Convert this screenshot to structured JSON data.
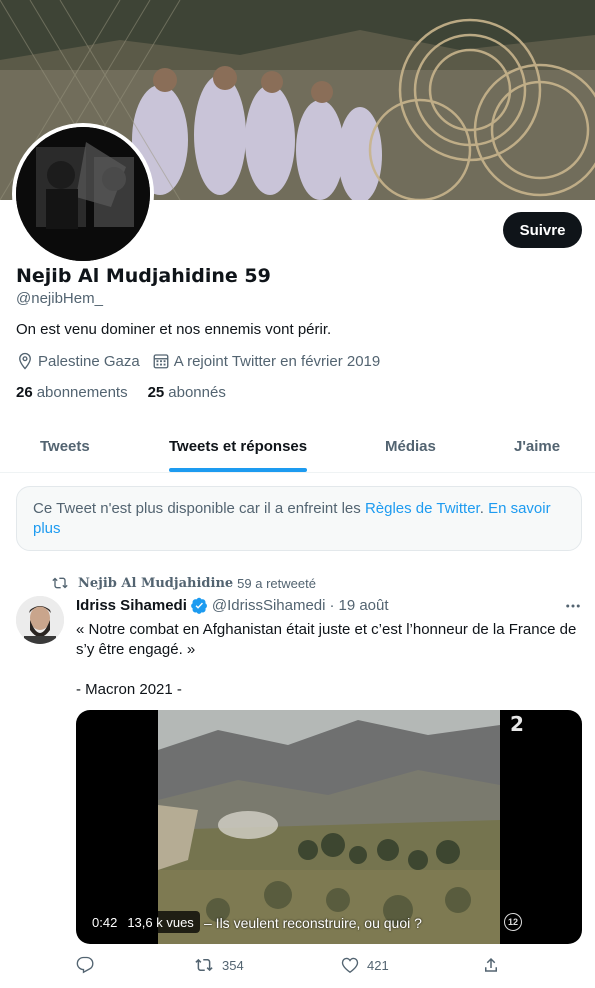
{
  "profile": {
    "name": "Nejib Al Mudjahidine 59",
    "handle": "@nejibHem_",
    "bio": "On est venu dominer et nos ennemis vont périr.",
    "location": "Palestine Gaza",
    "joined": "A rejoint Twitter en février 2019",
    "following_count": "26",
    "following_label": "abonnements",
    "followers_count": "25",
    "followers_label": "abonnés",
    "follow_button": "Suivre"
  },
  "tabs": [
    {
      "label": "Tweets",
      "active": false
    },
    {
      "label": "Tweets et réponses",
      "active": true
    },
    {
      "label": "Médias",
      "active": false
    },
    {
      "label": "J'aime",
      "active": false
    }
  ],
  "notice": {
    "text": "Ce Tweet n'est plus disponible car il a enfreint les ",
    "link1": "Règles de Twitter",
    "text2": ". ",
    "link2": "En savoir plus"
  },
  "retweet": {
    "retweeter": "Nejib Al Mudjahidine",
    "suffix": "59 a retweeté"
  },
  "tweet": {
    "author": "Idriss Sihamedi",
    "handle": "@IdrissSihamedi",
    "separator": "·",
    "date": "19 août",
    "lines": [
      "« Notre combat en Afghanistan était juste et c’est l’honneur de la France de s’y être engagé. »",
      "",
      "- Macron 2021 -"
    ],
    "video": {
      "duration": "0:42",
      "views": "13,6 k vues",
      "subtitle": "– Ils veulent reconstruire, ou quoi ?",
      "channel_logo": "2",
      "rating": "12"
    },
    "retweets": "354",
    "likes": "421"
  },
  "colors": {
    "accent": "#1d9bf0",
    "text": "#0f1419",
    "secondary": "#536471"
  }
}
